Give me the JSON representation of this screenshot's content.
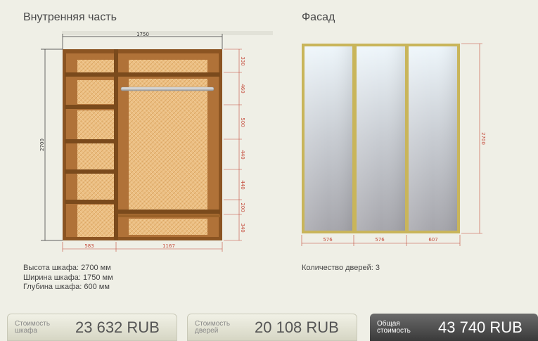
{
  "interior": {
    "title": "Внутренняя часть",
    "info": [
      "Высота шкафа: 2700 мм",
      "Ширина шкафа: 1750 мм",
      "Глубина шкафа: 600 мм"
    ],
    "dims": {
      "width": "1750",
      "height": "2700",
      "left_w": "583",
      "right_w": "1167",
      "segments": [
        "330",
        "460",
        "500",
        "440",
        "440",
        "200",
        "340"
      ]
    }
  },
  "facade": {
    "title": "Фасад",
    "info": "Количество дверей: 3",
    "dims": {
      "height": "2700",
      "doors": [
        "576",
        "576",
        "607"
      ]
    }
  },
  "totals": [
    {
      "label": "Стоимость шкафа",
      "value": "23 632  RUB"
    },
    {
      "label": "Стоимость дверей",
      "value": "20 108  RUB"
    },
    {
      "label": "Общая стоимость",
      "value": "43 740  RUB"
    }
  ],
  "colors": {
    "wood_dark": "#8b5422",
    "wood_fill": "#e9b879",
    "frame_gold": "#c9b55a",
    "dim_red": "#c44a3a"
  }
}
